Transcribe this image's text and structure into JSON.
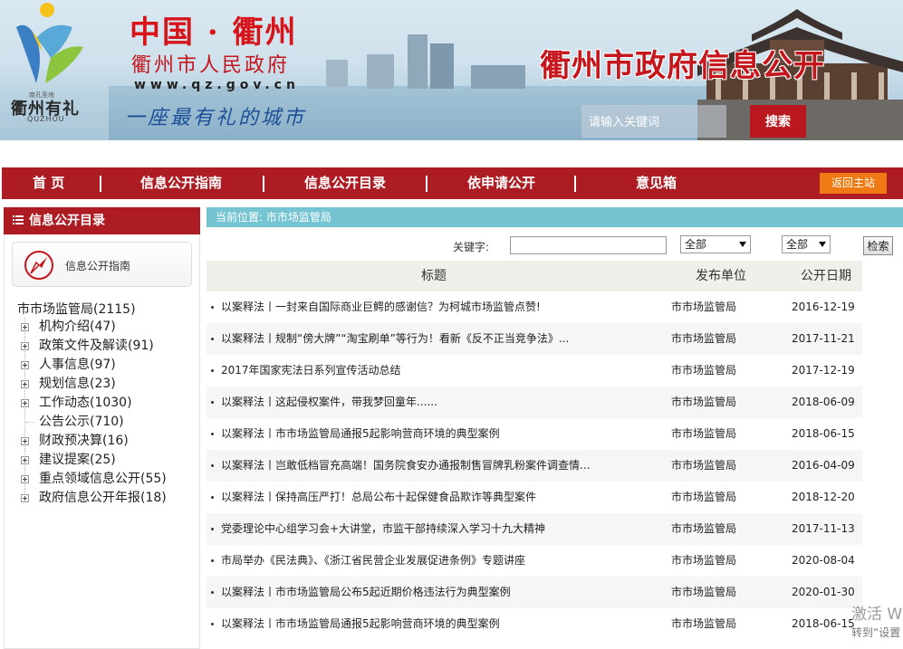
{
  "banner": {
    "city_title": "中国 · 衢州",
    "gov_name": "衢州市人民政府",
    "url": "www.qz.gov.cn",
    "slogan": "一座最有礼的城市",
    "portal_title": "衢州市政府信息公开",
    "logo_text": "衢州有礼",
    "logo_sub": "QUZHOU",
    "logo_tag": "南孔圣地",
    "search_placeholder": "请输入关键词",
    "search_button": "搜索"
  },
  "nav": {
    "items": [
      "首 页",
      "信息公开指南",
      "信息公开目录",
      "依申请公开",
      "意见箱"
    ],
    "home_button": "返回主站"
  },
  "sidebar": {
    "heading": "信息公开目录",
    "guide_card": "信息公开指南",
    "root": "市市场监管局(2115)",
    "items": [
      "机构介绍(47)",
      "政策文件及解读(91)",
      "人事信息(97)",
      "规划信息(23)",
      "工作动态(1030)",
      "公告公示(710)",
      "财政预决算(16)",
      "建议提案(25)",
      "重点领域信息公开(55)",
      "政府信息公开年报(18)"
    ]
  },
  "breadcrumb": "当前位置: 市市场监管局",
  "filter": {
    "keyword_label": "关键字:",
    "select1": "全部",
    "select2": "全部",
    "search_button": "检索"
  },
  "table": {
    "headers": [
      "标题",
      "发布单位",
      "公开日期"
    ],
    "rows": [
      {
        "title": "以案释法丨一封来自国际商业巨鳄的感谢信？为柯城市场监管点赞!",
        "unit": "市市场监管局",
        "date": "2016-12-19"
      },
      {
        "title": "以案释法丨规制“傍大牌”“淘宝刷单”等行为！看新《反不正当竞争法》...",
        "unit": "市市场监管局",
        "date": "2017-11-21"
      },
      {
        "title": "2017年国家宪法日系列宣传活动总结",
        "unit": "市市场监管局",
        "date": "2017-12-19"
      },
      {
        "title": "以案释法丨这起侵权案件，带我梦回童年......",
        "unit": "市市场监管局",
        "date": "2018-06-09"
      },
      {
        "title": "以案释法丨市市场监管局通报5起影响营商环境的典型案例",
        "unit": "市市场监管局",
        "date": "2018-06-15"
      },
      {
        "title": "以案释法丨岂敢低档冒充高端！国务院食安办通报制售冒牌乳粉案件调查情...",
        "unit": "市市场监管局",
        "date": "2016-04-09"
      },
      {
        "title": "以案释法丨保持高压严打！总局公布十起保健食品欺诈等典型案件",
        "unit": "市市场监管局",
        "date": "2018-12-20"
      },
      {
        "title": "党委理论中心组学习会+大讲堂，市监干部持续深入学习十九大精神",
        "unit": "市市场监管局",
        "date": "2017-11-13"
      },
      {
        "title": "市局举办《民法典》、《浙江省民营企业发展促进条例》专题讲座",
        "unit": "市市场监管局",
        "date": "2020-08-04"
      },
      {
        "title": "以案释法丨市市场监管局公布5起近期价格违法行为典型案例",
        "unit": "市市场监管局",
        "date": "2020-01-30"
      },
      {
        "title": "以案释法丨市市场监管局通报5起影响营商环境的典型案例",
        "unit": "市市场监管局",
        "date": "2018-06-15"
      }
    ]
  },
  "watermark": {
    "line1": "激活 W",
    "line2": "转到“设置"
  },
  "colors": {
    "brand_red": "#ac1c22",
    "orange": "#ef7a14",
    "crumb_teal": "#74c4d2"
  }
}
